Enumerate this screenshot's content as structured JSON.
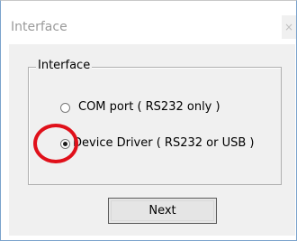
{
  "window": {
    "title": "Interface",
    "close_glyph": "×"
  },
  "group": {
    "legend": "Interface",
    "options": [
      {
        "label": "COM port ( RS232 only )",
        "selected": false
      },
      {
        "label": "Device Driver ( RS232 or USB )",
        "selected": true
      }
    ]
  },
  "buttons": {
    "next_label": "Next"
  },
  "colors": {
    "annotation": "#e0101a",
    "client_bg": "#f0f0f0"
  }
}
